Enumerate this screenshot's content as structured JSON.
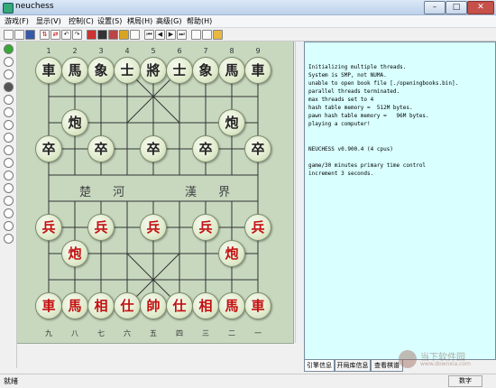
{
  "window": {
    "title": "neuchess",
    "min": "–",
    "max": "□",
    "close": "✕",
    "accent": "#c6514a"
  },
  "menu": [
    "游戏(F)",
    "显示(V)",
    "控制(C)",
    "设置(S)",
    "棋局(H)",
    "高级(G)",
    "帮助(H)"
  ],
  "files_top": [
    "1",
    "2",
    "3",
    "4",
    "5",
    "6",
    "7",
    "8",
    "9"
  ],
  "files_bottom": [
    "九",
    "八",
    "七",
    "六",
    "五",
    "四",
    "三",
    "二",
    "一"
  ],
  "river": {
    "left": "楚 河",
    "right": "漢 界"
  },
  "pieces": {
    "black_back": [
      "車",
      "馬",
      "象",
      "士",
      "將",
      "士",
      "象",
      "馬",
      "車"
    ],
    "black_cannon": "炮",
    "black_pawn": "卒",
    "red_back": [
      "車",
      "馬",
      "相",
      "仕",
      "帥",
      "仕",
      "相",
      "馬",
      "車"
    ],
    "red_cannon": "炮",
    "red_pawn": "兵"
  },
  "log": [
    "Initializing multiple threads.",
    "System is SMP, not NUMA.",
    "unable to open book file [./openingbooks.bin].",
    "parallel threads terminated.",
    "max threads set to 4",
    "hash table memory =  512M bytes.",
    "pawn hash table memory =   96M bytes.",
    "playing a computer!",
    "",
    "",
    "NEUCHESS v0.900.4 (4 cpus)",
    "",
    "game/30 minutes primary time control",
    "increment 3 seconds."
  ],
  "tabs": [
    "引擎信息",
    "开局库信息",
    "查看棋谱"
  ],
  "status": {
    "left": "就绪",
    "right": "数字"
  },
  "watermark": {
    "name": "当下软件园",
    "url": "www.downxia.com"
  }
}
